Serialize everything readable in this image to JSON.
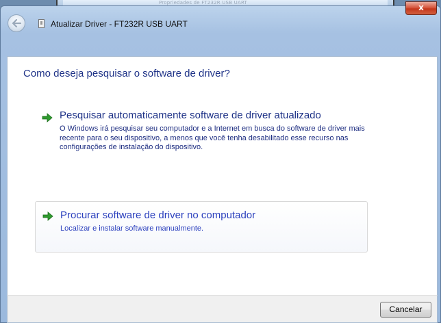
{
  "background_window": {
    "title": "Propriedades de FT232R USB UART"
  },
  "window": {
    "title": "Atualizar Driver - FT232R USB UART",
    "close_label": "x"
  },
  "content": {
    "heading": "Como deseja pesquisar o software de driver?",
    "options": [
      {
        "title": "Pesquisar automaticamente software de driver atualizado",
        "description": "O Windows irá pesquisar seu computador e a Internet em busca do software de driver mais recente para o seu dispositivo, a menos que você tenha desabilitado esse recurso nas configurações de instalação do dispositivo.",
        "icon": "green-arrow-icon"
      },
      {
        "title": "Procurar software de driver no computador",
        "description": "Localizar e instalar software manualmente.",
        "icon": "green-arrow-icon"
      }
    ]
  },
  "footer": {
    "cancel_label": "Cancelar"
  },
  "colors": {
    "link_blue": "#1e3287",
    "hover_blue": "#2a3fbd",
    "arrow_green": "#2e9a2e"
  }
}
